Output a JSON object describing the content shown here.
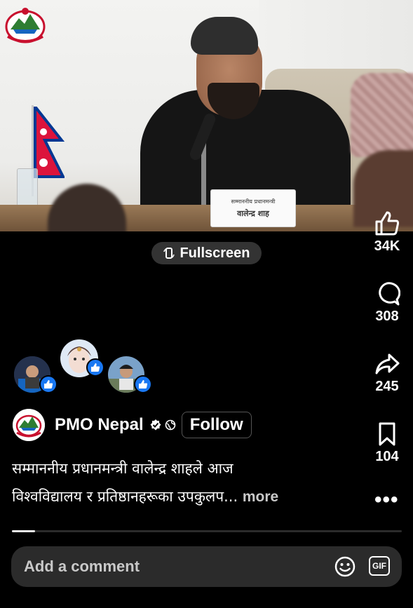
{
  "video": {
    "nameplate_line1": "सम्माननीय प्रधानमन्त्री",
    "nameplate_line2": "वालेन्द्र शाह",
    "fullscreen_label": "Fullscreen"
  },
  "rail": {
    "likes": "34K",
    "comments": "308",
    "shares": "245",
    "saves": "104",
    "more_icon": "more-dots-icon"
  },
  "reactors": [
    {
      "name": "reactor-1",
      "reaction": "like"
    },
    {
      "name": "reactor-2",
      "reaction": "like"
    },
    {
      "name": "reactor-3",
      "reaction": "like"
    }
  ],
  "author": {
    "name": "PMO Nepal",
    "verified": true,
    "audience_icon": "globe-icon",
    "follow_label": "Follow"
  },
  "caption": {
    "line1": "सम्माननीय प्रधानमन्त्री वालेन्द्र शाहले आज",
    "line2": "विश्वविद्यालय र प्रतिष्ठानहरूका उपकुलप...",
    "more_label": "more"
  },
  "progress": {
    "fraction": 0.06
  },
  "comment": {
    "placeholder": "Add a comment",
    "gif_label": "GIF"
  },
  "colors": {
    "background": "#000000",
    "like_badge": "#1877f2",
    "pill": "#333333",
    "comment_bar": "#2b2b2b"
  }
}
